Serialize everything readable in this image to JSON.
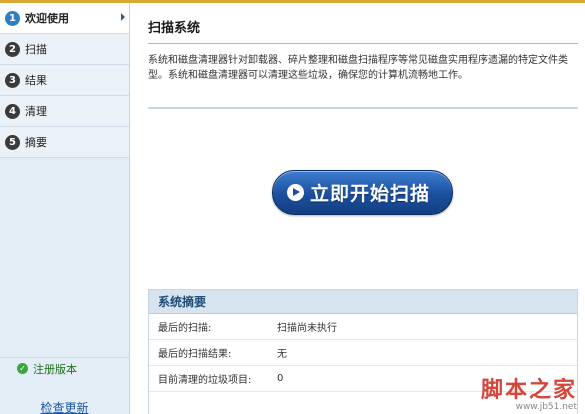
{
  "sidebar": {
    "steps": [
      {
        "num": "1",
        "label": "欢迎使用"
      },
      {
        "num": "2",
        "label": "扫描"
      },
      {
        "num": "3",
        "label": "结果"
      },
      {
        "num": "4",
        "label": "清理"
      },
      {
        "num": "5",
        "label": "摘要"
      }
    ],
    "registered_label": "注册版本",
    "update_label": "检查更新"
  },
  "main": {
    "title": "扫描系统",
    "description": "系统和磁盘清理器针对卸载器、碎片整理和磁盘扫描程序等常见磁盘实用程序遗漏的特定文件类型。系统和磁盘清理器可以清理这些垃圾，确保您的计算机流畅地工作。",
    "scan_button_label": "立即开始扫描",
    "summary": {
      "title": "系统摘要",
      "rows": [
        {
          "key": "最后的扫描:",
          "value": "扫描尚未执行"
        },
        {
          "key": "最后的扫描结果:",
          "value": "无"
        },
        {
          "key": "目前清理的垃圾项目:",
          "value": "0"
        }
      ]
    }
  },
  "watermark": {
    "main": "脚本之家",
    "sub": "www.jb51.net"
  },
  "colors": {
    "accent": "#2d7fc1",
    "button": "#1b4f9e",
    "registered": "#3aa63a"
  }
}
